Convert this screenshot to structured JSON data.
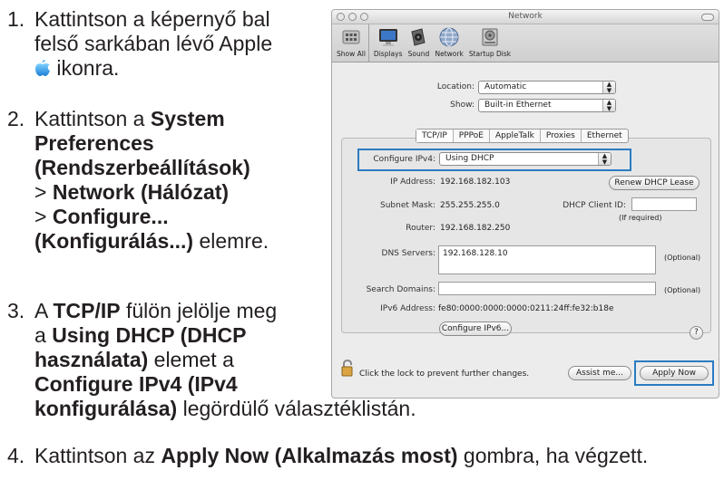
{
  "instructions": {
    "step1": {
      "num": "1.",
      "line1": "Kattintson a képernyő bal",
      "line2": "felső sarkában lévő Apple",
      "line3": "ikonra.",
      "icon": "apple-icon"
    },
    "step2": {
      "num": "2.",
      "line1": "Kattintson a ",
      "bold1": "System",
      "bold2": "Preferences",
      "bold3": "(Rendszerbeállítások)",
      "gt1": "> ",
      "bold4": "Network (Hálózat)",
      "gt2": "> ",
      "bold5": "Configure...",
      "bold6": "(Konfigurálás...)",
      "tail": " elemre."
    },
    "step3": {
      "num": "3.",
      "a": "A ",
      "bold1": "TCP/IP",
      "t1": " fülön jelölje meg",
      "a2": "a ",
      "bold2": "Using DHCP (DHCP",
      "bold3": "használata)",
      "t2": " elemet a",
      "bold4": "Configure IPv4 (IPv4",
      "bold5": "konfigurálása)",
      "t3": " legördülő választéklistán."
    },
    "step4": {
      "num": "4.",
      "a": "Kattintson az ",
      "bold": "Apply Now (Alkalmazás most)",
      "t": " gombra, ha végzett."
    }
  },
  "window": {
    "title": "Network",
    "toolbar": [
      {
        "label": "Show All",
        "icon": "show-all-icon"
      },
      {
        "label": "Displays",
        "icon": "displays-icon"
      },
      {
        "label": "Sound",
        "icon": "sound-icon"
      },
      {
        "label": "Network",
        "icon": "network-icon"
      },
      {
        "label": "Startup Disk",
        "icon": "startup-disk-icon"
      }
    ],
    "location": {
      "label": "Location:",
      "value": "Automatic"
    },
    "show": {
      "label": "Show:",
      "value": "Built-in Ethernet"
    },
    "tabs": [
      "TCP/IP",
      "PPPoE",
      "AppleTalk",
      "Proxies",
      "Ethernet"
    ],
    "configure": {
      "label": "Configure IPv4:",
      "value": "Using DHCP"
    },
    "ip": {
      "label": "IP Address:",
      "value": "192.168.182.103"
    },
    "renew_button": "Renew DHCP Lease",
    "subnet": {
      "label": "Subnet Mask:",
      "value": "255.255.255.0"
    },
    "client_id": {
      "label": "DHCP Client ID:",
      "value": "",
      "note": "(If required)"
    },
    "router": {
      "label": "Router:",
      "value": "192.168.182.250"
    },
    "dns": {
      "label": "DNS Servers:",
      "value": "192.168.128.10",
      "note": "(Optional)"
    },
    "search": {
      "label": "Search Domains:",
      "value": "",
      "note": "(Optional)"
    },
    "ipv6": {
      "label": "IPv6 Address:",
      "value": "fe80:0000:0000:0000:0211:24ff:fe32:b18e"
    },
    "configure_ipv6_button": "Configure IPv6...",
    "help": "?",
    "lock_text": "Click the lock to prevent further changes.",
    "assist_button": "Assist me...",
    "apply_button": "Apply Now",
    "highlight_color": "#2b7bc2"
  }
}
